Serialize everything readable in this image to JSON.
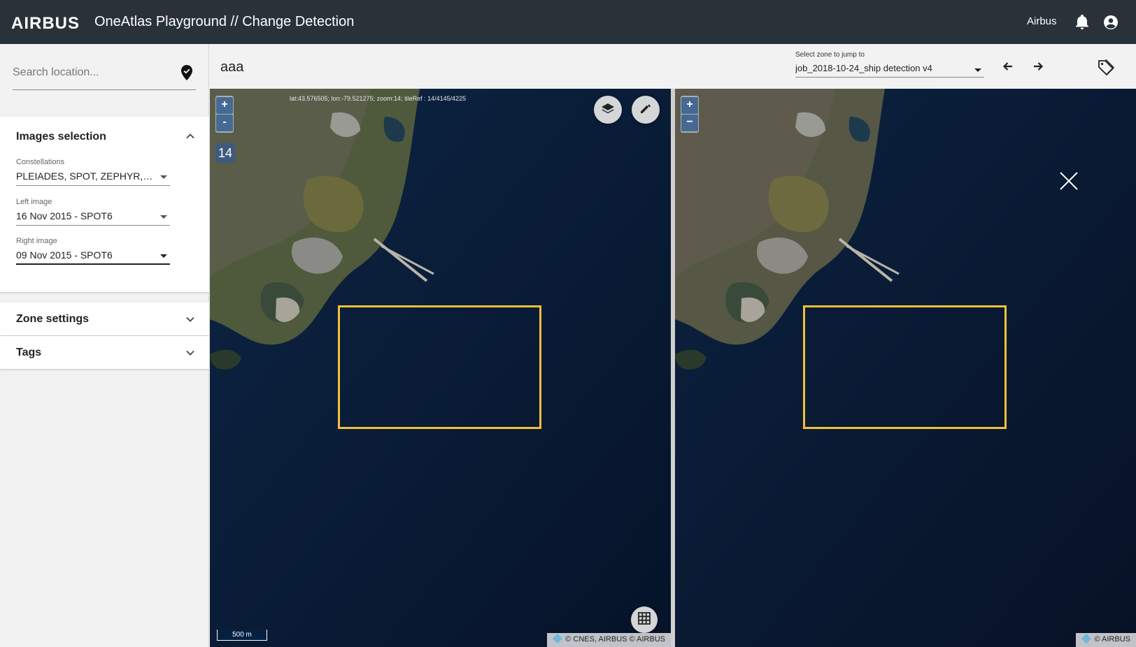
{
  "header": {
    "logo": "AIRBUS",
    "title": "OneAtlas Playground // Change Detection",
    "user": "Airbus"
  },
  "sidebar": {
    "search_placeholder": "Search location...",
    "images_selection": {
      "title": "Images selection",
      "constellations_label": "Constellations",
      "constellations_value": "PLEIADES, SPOT, ZEPHYR, Deimos",
      "left_image_label": "Left image",
      "left_image_value": "16 Nov 2015 - SPOT6",
      "right_image_label": "Right image",
      "right_image_value": "09 Nov 2015 - SPOT6"
    },
    "zone_settings_title": "Zone settings",
    "tags_title": "Tags"
  },
  "toolbar": {
    "zone_name": "aaa",
    "zone_select_label": "Select zone to jump to",
    "zone_select_value": "job_2018-10-24_ship detection v4"
  },
  "map_left": {
    "zoom_in": "+",
    "zoom_out": "-",
    "zoom_level": "14",
    "coords": "lat:43.576505; lon:-79.521275; zoom:14; tileRef : 14/4145/4225",
    "scale": "500 m",
    "attribution": "© CNES, AIRBUS © AIRBUS"
  },
  "map_right": {
    "zoom_in": "+",
    "zoom_out": "−",
    "attribution": "© AIRBUS"
  },
  "colors": {
    "header_bg": "#2a3239",
    "water": "#08172e",
    "bbox": "#f2c03a"
  }
}
